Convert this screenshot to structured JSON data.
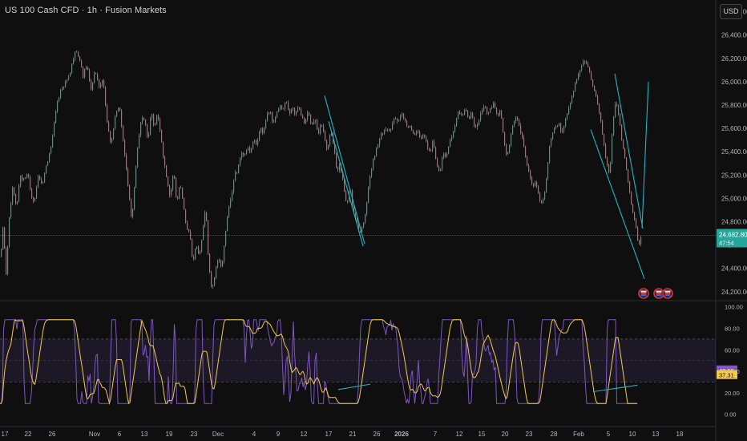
{
  "header": {
    "title": "US 100 Cash CFD · 1h · Fusion Markets",
    "currency_button": "USD"
  },
  "colors": {
    "up": "#26a69a",
    "down": "#ef5350",
    "rsi": "#7e57c2",
    "rsi_ma": "#f2c94c",
    "trendline": "#24b3c4",
    "background": "#0f0f0f"
  },
  "chart_data": [
    {
      "type": "candlestick",
      "ylim": [
        24130,
        26700
      ],
      "yticks": [
        "26,600.00",
        "26,400.00",
        "26,200.00",
        "26,000.00",
        "25,800.00",
        "25,600.00",
        "25,400.00",
        "25,200.00",
        "25,000.00",
        "24,800.00",
        "24,600.00",
        "24,400.00",
        "24,200.00"
      ],
      "ytick_values": [
        26600,
        26400,
        26200,
        26000,
        25800,
        25600,
        25400,
        25200,
        25000,
        24800,
        24600,
        24400,
        24200
      ],
      "last_price": "24,682.80",
      "last_price_value": 24682.8,
      "countdown": "47:54",
      "path": [
        [
          0,
          24500
        ],
        [
          3,
          24750
        ],
        [
          7,
          24360
        ],
        [
          11,
          24830
        ],
        [
          15,
          25100
        ],
        [
          20,
          24900
        ],
        [
          24,
          25200
        ],
        [
          30,
          25150
        ],
        [
          34,
          25230
        ],
        [
          38,
          25050
        ],
        [
          42,
          24950
        ],
        [
          47,
          25200
        ],
        [
          52,
          25100
        ],
        [
          57,
          25280
        ],
        [
          62,
          25400
        ],
        [
          66,
          25600
        ],
        [
          70,
          25800
        ],
        [
          74,
          25900
        ],
        [
          80,
          25980
        ],
        [
          86,
          26050
        ],
        [
          90,
          26180
        ],
        [
          94,
          26270
        ],
        [
          98,
          26200
        ],
        [
          103,
          26050
        ],
        [
          108,
          26150
        ],
        [
          113,
          25950
        ],
        [
          118,
          26080
        ],
        [
          123,
          25950
        ],
        [
          128,
          26020
        ],
        [
          133,
          25650
        ],
        [
          138,
          25450
        ],
        [
          143,
          25700
        ],
        [
          148,
          25800
        ],
        [
          152,
          25550
        ],
        [
          156,
          25300
        ],
        [
          160,
          25050
        ],
        [
          164,
          24800
        ],
        [
          168,
          25200
        ],
        [
          172,
          25500
        ],
        [
          176,
          25700
        ],
        [
          180,
          25650
        ],
        [
          184,
          25500
        ],
        [
          188,
          25750
        ],
        [
          192,
          25600
        ],
        [
          196,
          25720
        ],
        [
          200,
          25550
        ],
        [
          204,
          25300
        ],
        [
          208,
          25150
        ],
        [
          212,
          25000
        ],
        [
          216,
          25250
        ],
        [
          220,
          24950
        ],
        [
          224,
          25150
        ],
        [
          228,
          24950
        ],
        [
          232,
          24750
        ],
        [
          236,
          24700
        ],
        [
          240,
          24450
        ],
        [
          244,
          24620
        ],
        [
          248,
          24500
        ],
        [
          252,
          24700
        ],
        [
          256,
          24950
        ],
        [
          260,
          24400
        ],
        [
          264,
          24200
        ],
        [
          268,
          24380
        ],
        [
          272,
          24500
        ],
        [
          276,
          24380
        ],
        [
          280,
          24650
        ],
        [
          284,
          24900
        ],
        [
          288,
          25000
        ],
        [
          292,
          25200
        ],
        [
          296,
          25250
        ],
        [
          300,
          25400
        ],
        [
          304,
          25350
        ],
        [
          308,
          25450
        ],
        [
          312,
          25400
        ],
        [
          316,
          25500
        ],
        [
          320,
          25450
        ],
        [
          324,
          25600
        ],
        [
          328,
          25550
        ],
        [
          332,
          25700
        ],
        [
          336,
          25750
        ],
        [
          340,
          25650
        ],
        [
          344,
          25720
        ],
        [
          348,
          25800
        ],
        [
          352,
          25750
        ],
        [
          356,
          25850
        ],
        [
          360,
          25700
        ],
        [
          364,
          25780
        ],
        [
          368,
          25720
        ],
        [
          372,
          25800
        ],
        [
          376,
          25700
        ],
        [
          380,
          25650
        ],
        [
          384,
          25750
        ],
        [
          388,
          25620
        ],
        [
          392,
          25700
        ],
        [
          396,
          25550
        ],
        [
          400,
          25650
        ],
        [
          404,
          25550
        ],
        [
          408,
          25400
        ],
        [
          412,
          25600
        ],
        [
          416,
          25450
        ],
        [
          420,
          25200
        ],
        [
          424,
          25300
        ],
        [
          428,
          25100
        ],
        [
          432,
          24950
        ],
        [
          436,
          25100
        ],
        [
          440,
          24900
        ],
        [
          444,
          24800
        ],
        [
          448,
          24700
        ],
        [
          452,
          24750
        ],
        [
          456,
          24900
        ],
        [
          460,
          25150
        ],
        [
          464,
          25300
        ],
        [
          468,
          25400
        ],
        [
          472,
          25500
        ],
        [
          476,
          25550
        ],
        [
          480,
          25600
        ],
        [
          484,
          25580
        ],
        [
          488,
          25620
        ],
        [
          492,
          25700
        ],
        [
          496,
          25660
        ],
        [
          500,
          25720
        ],
        [
          504,
          25680
        ],
        [
          508,
          25600
        ],
        [
          512,
          25620
        ],
        [
          516,
          25550
        ],
        [
          520,
          25580
        ],
        [
          524,
          25500
        ],
        [
          528,
          25550
        ],
        [
          532,
          25450
        ],
        [
          536,
          25400
        ],
        [
          540,
          25500
        ],
        [
          544,
          25300
        ],
        [
          548,
          25200
        ],
        [
          552,
          25400
        ],
        [
          556,
          25350
        ],
        [
          560,
          25480
        ],
        [
          564,
          25550
        ],
        [
          568,
          25650
        ],
        [
          572,
          25750
        ],
        [
          576,
          25700
        ],
        [
          580,
          25780
        ],
        [
          584,
          25680
        ],
        [
          588,
          25750
        ],
        [
          592,
          25600
        ],
        [
          596,
          25650
        ],
        [
          600,
          25750
        ],
        [
          604,
          25800
        ],
        [
          608,
          25700
        ],
        [
          612,
          25780
        ],
        [
          616,
          25820
        ],
        [
          620,
          25700
        ],
        [
          624,
          25760
        ],
        [
          628,
          25500
        ],
        [
          632,
          25350
        ],
        [
          636,
          25500
        ],
        [
          640,
          25650
        ],
        [
          644,
          25700
        ],
        [
          648,
          25600
        ],
        [
          652,
          25500
        ],
        [
          656,
          25300
        ],
        [
          660,
          25200
        ],
        [
          664,
          25100
        ],
        [
          668,
          25150
        ],
        [
          672,
          25000
        ],
        [
          676,
          24950
        ],
        [
          680,
          25100
        ],
        [
          684,
          25400
        ],
        [
          688,
          25550
        ],
        [
          692,
          25600
        ],
        [
          696,
          25650
        ],
        [
          700,
          25550
        ],
        [
          704,
          25650
        ],
        [
          708,
          25750
        ],
        [
          712,
          25850
        ],
        [
          716,
          25950
        ],
        [
          720,
          26050
        ],
        [
          724,
          26100
        ],
        [
          728,
          26200
        ],
        [
          732,
          26150
        ],
        [
          736,
          26050
        ],
        [
          740,
          25950
        ],
        [
          744,
          25850
        ],
        [
          748,
          25700
        ],
        [
          752,
          25500
        ],
        [
          756,
          25300
        ],
        [
          760,
          25200
        ],
        [
          764,
          25650
        ],
        [
          768,
          25850
        ],
        [
          772,
          25700
        ],
        [
          776,
          25450
        ],
        [
          780,
          25300
        ],
        [
          784,
          25100
        ],
        [
          788,
          24900
        ],
        [
          792,
          24800
        ],
        [
          796,
          24600
        ],
        [
          800,
          24682
        ]
      ],
      "trendlines": [
        [
          [
            405,
            25880
          ],
          [
            455,
            24610
          ]
        ],
        [
          [
            410,
            25660
          ],
          [
            453,
            24590
          ]
        ],
        [
          [
            737,
            25590
          ],
          [
            804,
            24310
          ]
        ],
        [
          [
            767,
            26070
          ],
          [
            802,
            24740
          ]
        ],
        [
          [
            801,
            24750
          ],
          [
            809,
            26000
          ]
        ]
      ],
      "event_markers": [
        803,
        822,
        833
      ]
    },
    {
      "type": "line",
      "series": [
        {
          "role": "rsi"
        },
        {
          "role": "rsi_ma"
        }
      ],
      "ylim": [
        -10,
        105
      ],
      "yticks": [
        "100.00",
        "80.00",
        "60.00",
        "40.00",
        "20.00",
        "0.00"
      ],
      "ytick_values": [
        100,
        80,
        60,
        40,
        20,
        0
      ],
      "bands": [
        70,
        50,
        30
      ],
      "last_rsi": "40.96",
      "last_rsi_ma": "37.31",
      "last_rsi_value": 40.96,
      "last_rsi_ma_value": 37.31,
      "divergence_lines": [
        [
          [
            422,
            23
          ],
          [
            462,
            28
          ]
        ],
        [
          [
            740,
            21
          ],
          [
            795,
            27
          ]
        ]
      ]
    }
  ],
  "x_axis": {
    "labels": [
      "17",
      "22",
      "26",
      "Nov",
      "6",
      "13",
      "19",
      "23",
      "Dec",
      "4",
      "9",
      "12",
      "17",
      "21",
      "26",
      "2026",
      "7",
      "12",
      "15",
      "20",
      "23",
      "28",
      "Feb",
      "5",
      "10",
      "13",
      "18"
    ],
    "label_positions": [
      6,
      35,
      65,
      118,
      149,
      180,
      211,
      242,
      272,
      317,
      347,
      379,
      410,
      440,
      470,
      501,
      543,
      573,
      601,
      630,
      660,
      691,
      722,
      759,
      789,
      818,
      848,
      877
    ]
  }
}
